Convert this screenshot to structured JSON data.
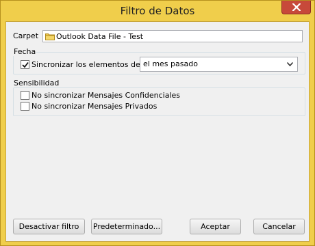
{
  "window": {
    "title": "Filtro de Datos"
  },
  "folder": {
    "label": "Carpet",
    "value": "Outlook Data File - Test"
  },
  "fecha": {
    "group_title": "Fecha",
    "sync_checkbox_label": "Sincronizar los elementos desde",
    "sync_checked": true,
    "range_select_value": "el mes pasado"
  },
  "sensibilidad": {
    "group_title": "Sensibilidad",
    "options": [
      {
        "label": "No sincronizar Mensajes Confidenciales",
        "checked": false
      },
      {
        "label": "No sincronizar Mensajes Privados",
        "checked": false
      }
    ]
  },
  "buttons": {
    "disable_filter": "Desactivar filtro",
    "default": "Predeterminado...",
    "accept": "Aceptar",
    "cancel": "Cancelar"
  },
  "colors": {
    "titlebar": "#f0ce4b",
    "close_button": "#c7493a",
    "folder_icon": "#e8c14a"
  },
  "icons": {
    "close": "close-icon",
    "folder": "folder-icon",
    "check": "check-icon",
    "dropdown": "chevron-down-icon"
  }
}
